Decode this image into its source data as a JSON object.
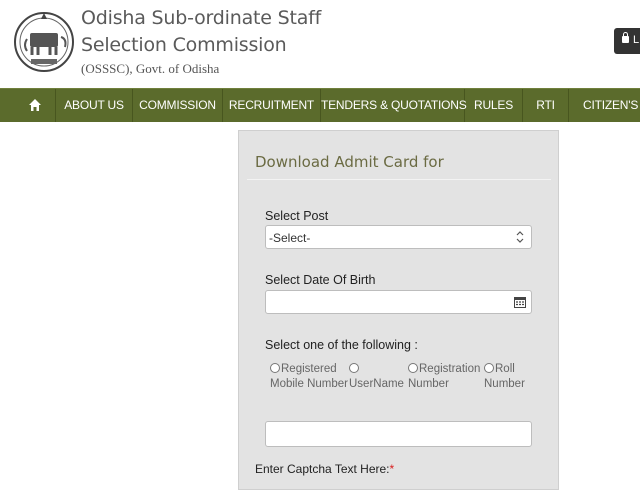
{
  "header": {
    "org_name_line1": "Odisha Sub-ordinate Staff",
    "org_name_line2": "Selection Commission",
    "org_sub": "(OSSSC), Govt. of Odisha",
    "login_text": "L"
  },
  "nav": {
    "home_icon": "home-icon",
    "items": [
      {
        "label": "ABOUT US"
      },
      {
        "label": "COMMISSION"
      },
      {
        "label": "RECRUITMENT"
      },
      {
        "label": "TENDERS & QUOTATIONS"
      },
      {
        "label": "RULES"
      },
      {
        "label": "RTI"
      },
      {
        "label": "CITIZEN'S CH"
      }
    ]
  },
  "form": {
    "title": "Download Admit Card for",
    "post_label": "Select Post",
    "post_value": "-Select-",
    "dob_label": "Select Date Of Birth",
    "dob_value": "",
    "choice_label": "Select one of the following :",
    "options": [
      {
        "line1": "Registered",
        "line2": "Mobile Number"
      },
      {
        "line1": "",
        "line2": "UserName"
      },
      {
        "line1": "Registration",
        "line2": "Number"
      },
      {
        "line1": "Roll",
        "line2": "Number"
      }
    ],
    "choice_value": "",
    "captcha_label": "Enter Captcha Text Here:",
    "required_mark": "*"
  },
  "colors": {
    "nav_bg": "#5b6b2c",
    "panel_bg": "#e3e3e3",
    "title_color": "#6b6b43"
  }
}
